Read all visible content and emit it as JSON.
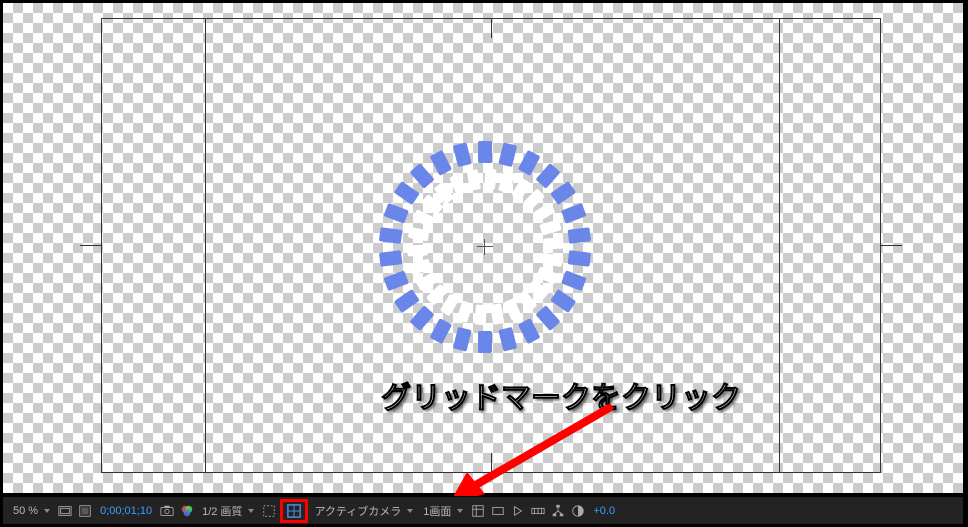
{
  "annotation": {
    "text": "グリッドマークをクリック"
  },
  "toolbar": {
    "zoom": "50 %",
    "timecode": "0;00;01;10",
    "resolution": "1/2 画質",
    "camera": "アクティブカメラ",
    "viewCount": "1画面",
    "exposure": "+0.0"
  },
  "icons": {
    "magnify": "magnify-icon",
    "safezone": "safezone-icon",
    "mask": "mask-icon",
    "snapshot": "snapshot-icon",
    "channels": "channels-icon",
    "transparency": "transparency-icon",
    "grid": "grid-icon",
    "guides": "guides-icon",
    "rulers": "rulers-icon",
    "tree": "tree-icon",
    "pixelAspect": "pixel-aspect-icon",
    "timeline": "timeline-icon",
    "exposure": "exposure-icon"
  },
  "ring": {
    "dashCount": 26,
    "radiusBlue": 95,
    "radiusWhite": 68,
    "colorBlue": "#6a86e8",
    "colorWhite": "#ffffff"
  }
}
